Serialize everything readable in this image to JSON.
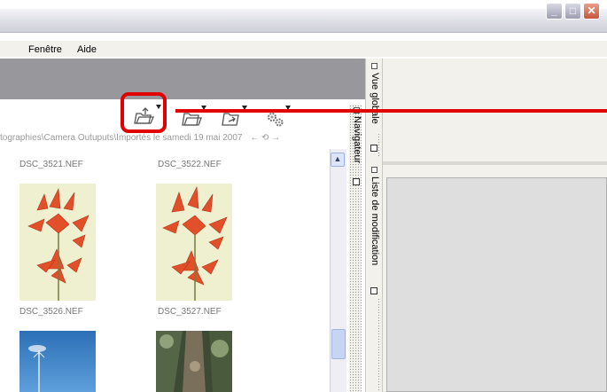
{
  "menu": {
    "items": [
      "Fenêtre",
      "Aide"
    ]
  },
  "window_controls": {
    "minimize": "_",
    "maximize": "□",
    "close": "✕"
  },
  "toolbar": {
    "icons": [
      "open-folder-icon",
      "folder-icon",
      "folder-arrow-icon",
      "gear-icon"
    ]
  },
  "path": {
    "text": "tographies\\Camera Outuputs\\Importés le samedi 19 mai 2007",
    "nav": "← ⟲ →"
  },
  "thumbnails": [
    {
      "name": "DSC_3521.NEF"
    },
    {
      "name": "DSC_3522.NEF"
    },
    {
      "name": "DSC_3526.NEF"
    },
    {
      "name": "DSC_3527.NEF"
    }
  ],
  "panels": {
    "vue_globale": "Vue globale",
    "navigateur": "Navigateur",
    "liste_modification": "Liste de modification"
  },
  "colors": {
    "annotation": "#e00000",
    "dark_band": "#98989c"
  }
}
